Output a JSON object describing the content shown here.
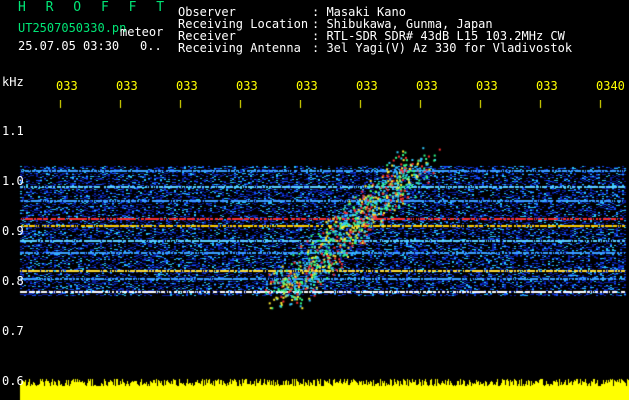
{
  "header": {
    "title": "H R O F F T",
    "file_name": "UT2507050330.pn",
    "meteor_label": "meteor",
    "datetime": "25.07.05 03:30",
    "counter": "0.."
  },
  "info": [
    {
      "key": "Observer",
      "value": ": Masaki Kano"
    },
    {
      "key": "Receiving Location",
      "value": ": Shibukawa, Gunma, Japan"
    },
    {
      "key": "Receiver",
      "value": ": RTL-SDR SDR# 43dB L15 103.2MHz CW"
    },
    {
      "key": "Receiving Antenna",
      "value": ": 3el Yagi(V) Az 330 for Vladivostok"
    }
  ],
  "axis": {
    "y_unit": "kHz",
    "y_ticks": [
      "1.1",
      "1.0",
      "0.9",
      "0.8",
      "0.7",
      "0.6"
    ],
    "x_ticks": [
      "033",
      "033",
      "033",
      "033",
      "033",
      "033",
      "033",
      "033",
      "033",
      "0340"
    ]
  },
  "colors": {
    "background": "#000000",
    "header_green": "#00e676",
    "axis_yellow": "#ffff00",
    "noise_blue": "#1a3cff",
    "signal_red": "#ff2a2a"
  }
}
